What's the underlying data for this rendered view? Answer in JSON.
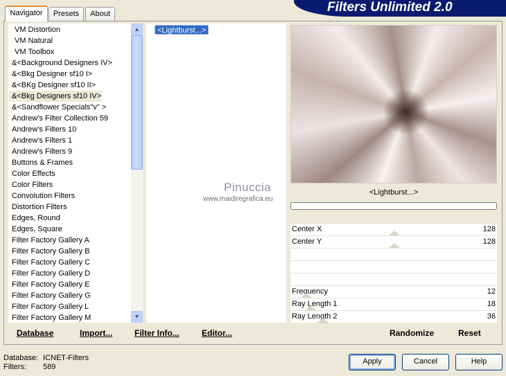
{
  "tabs": [
    {
      "label": "Navigator",
      "active": true
    },
    {
      "label": "Presets",
      "active": false
    },
    {
      "label": "About",
      "active": false
    }
  ],
  "banner_title": "Filters Unlimited 2.0",
  "categories": [
    "VM Distortion",
    "VM Natural",
    "VM Toolbox",
    "&<Background Designers IV>",
    "&<Bkg Designer sf10 I>",
    "&<BKg Designer sf10 II>",
    "&<Bkg Designers sf10 IV>",
    "&<Sandflower Specials\"v\" >",
    "Andrew's Filter Collection 59",
    "Andrew's Filters 10",
    "Andrew's Filters 1",
    "Andrew's Filters 9",
    "Buttons & Frames",
    "Color Effects",
    "Color Filters",
    "Convolution Filters",
    "Distortion Filters",
    "Edges, Round",
    "Edges, Square",
    "Filter Factory Gallery A",
    "Filter Factory Gallery B",
    "Filter Factory Gallery C",
    "Filter Factory Gallery D",
    "Filter Factory Gallery E",
    "Filter Factory Gallery G",
    "Filter Factory Gallery L",
    "Filter Factory Gallery M"
  ],
  "selected_category_index": 6,
  "filters": [
    "<Lightburst...>"
  ],
  "watermark": {
    "name": "Pinuccia",
    "url": "www.maidiregrafica.eu"
  },
  "preview_filter_name": "<Lightburst...>",
  "sliders": [
    {
      "label": "Center X",
      "value": "128"
    },
    {
      "label": "Center Y",
      "value": "128"
    },
    {
      "label": "",
      "value": ""
    },
    {
      "label": "",
      "value": ""
    },
    {
      "label": "Frequency",
      "value": "12"
    },
    {
      "label": "Ray Length 1",
      "value": "18"
    },
    {
      "label": "Ray Length 2",
      "value": "36"
    }
  ],
  "toolbar": {
    "database": "Database",
    "import": "Import...",
    "filter_info": "Filter Info...",
    "editor": "Editor...",
    "randomize": "Randomize",
    "reset": "Reset"
  },
  "status": {
    "database_label": "Database:",
    "database_value": "ICNET-Filters",
    "filters_label": "Filters:",
    "filters_value": "589"
  },
  "buttons": {
    "apply": "Apply",
    "cancel": "Cancel",
    "help": "Help"
  }
}
